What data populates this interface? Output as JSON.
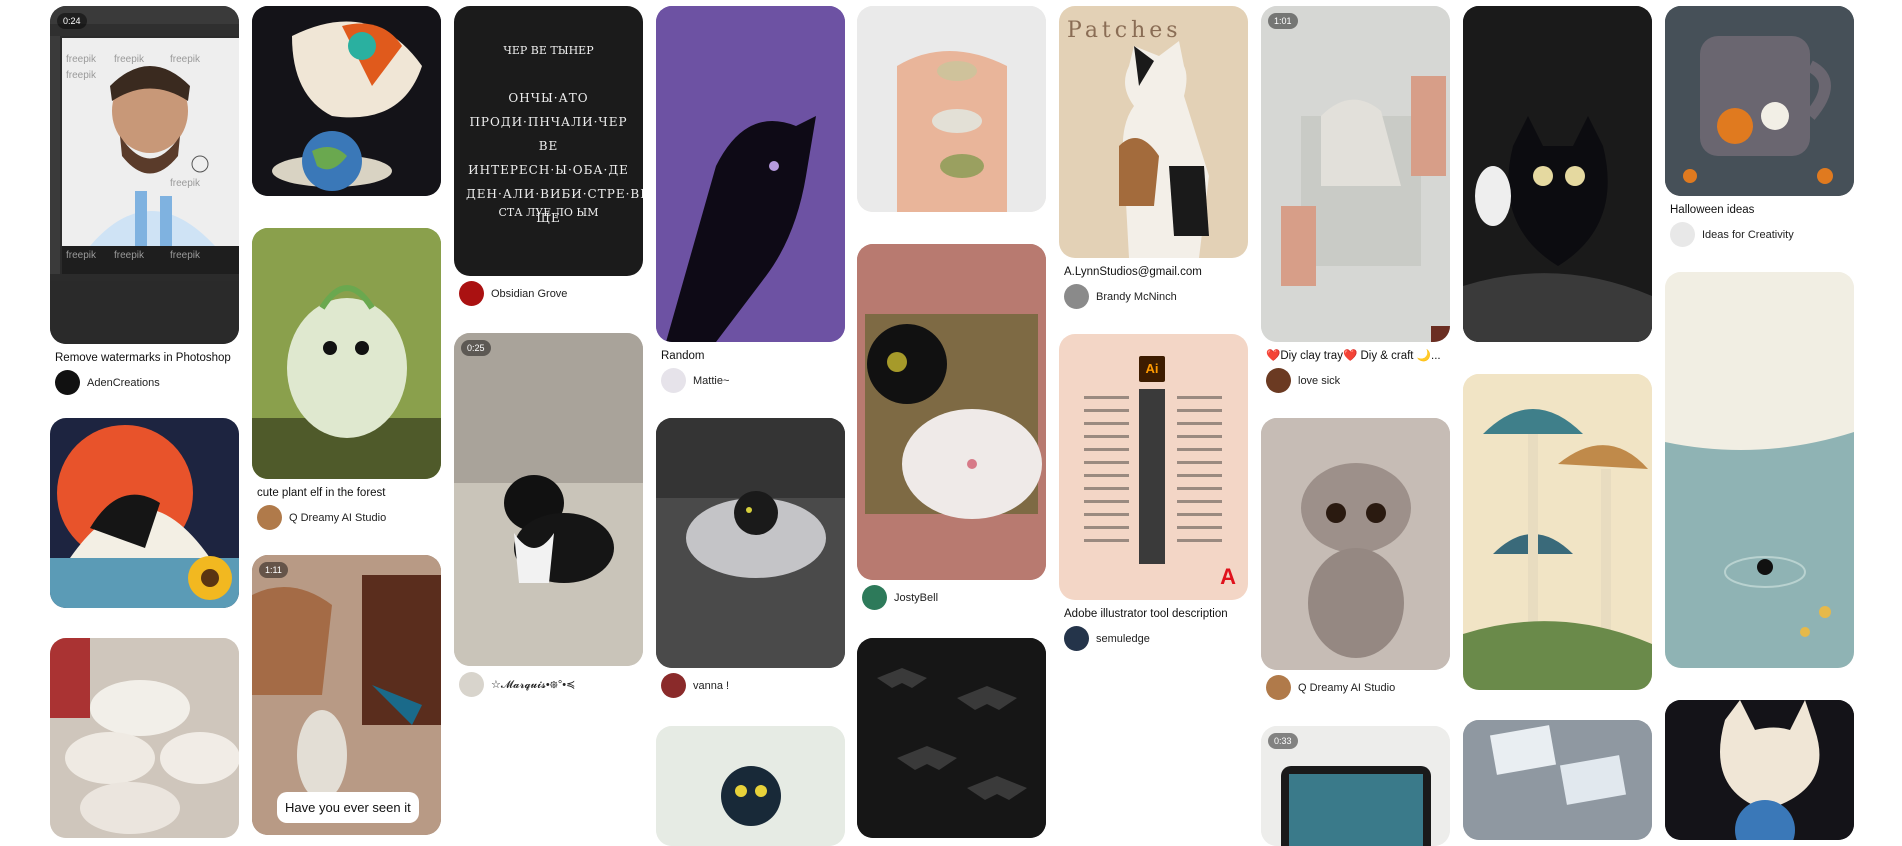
{
  "pins": {
    "p1": {
      "badge": "0:24",
      "title": "Remove watermarks in Photoshop",
      "author": "AdenCreations",
      "watermark": "freepik"
    },
    "p2": {},
    "p3": {},
    "c2p1": {},
    "c2p2": {
      "title": "cute plant elf in the forest",
      "author": "Q Dreamy AI Studio"
    },
    "c2p3": {
      "badge": "1:11",
      "caption": "Have you ever seen it"
    },
    "c3p1": {
      "author": "Obsidian Grove",
      "script_top": "ЧЕР ВЕ ТЫНЕР",
      "script_body": "ОНЧЫ·АТО ПРОДИ·ПНЧАЛИ·ЧЕР ВЕ ИНТЕРЕСН·Ы·ОБА·ДЕ ДЕН·АЛИ·ВИБИ·СТРЕ·ВЕ ЩЕ",
      "script_bottom": "СТА ЛУЕ ЛО ЫМ"
    },
    "c3p2": {
      "badge": "0:25",
      "author": "☆𝓜𝓪𝓻𝓺𝓾𝓲𝓼•᪥°•≼"
    },
    "c4p1": {
      "title": "Random",
      "author": "Mattie~"
    },
    "c4p2": {
      "author": "vanna !"
    },
    "c4p3": {},
    "c5p1": {},
    "c5p2": {
      "author": "JostyBell"
    },
    "c5p3": {},
    "c6p1": {
      "brand": "Patches",
      "title": "A.LynnStudios@gmail.com",
      "author": "Brandy McNinch"
    },
    "c6p2": {
      "logo": "Ai",
      "title": "Adobe illustrator tool description",
      "author": "semuledge"
    },
    "c7p1": {
      "badge": "1:01",
      "title": "❤️Diy clay tray❤️ Diy & craft 🌙...",
      "author": "love sick"
    },
    "c7p2": {
      "author": "Q Dreamy AI Studio"
    },
    "c7p3": {
      "badge": "0:33"
    },
    "c8p1": {},
    "c8p2": {},
    "c8p3": {},
    "c9p1": {
      "title": "Halloween ideas",
      "author": "Ideas for Creativity"
    },
    "c9p2": {},
    "c9p3": {}
  },
  "colors": {
    "bg": "#ffffff",
    "text": "#111111",
    "accent_red": "#e0121c"
  }
}
